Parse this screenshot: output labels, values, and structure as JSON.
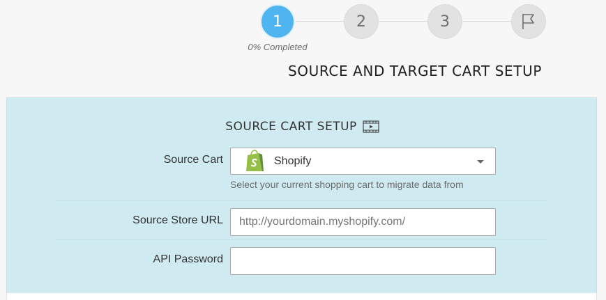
{
  "wizard": {
    "steps": [
      {
        "label": "1",
        "state": "active"
      },
      {
        "label": "2",
        "state": "pending"
      },
      {
        "label": "3",
        "state": "pending"
      },
      {
        "label": "",
        "icon": "flag-icon",
        "state": "pending"
      }
    ],
    "progress_text": "0% Completed",
    "progress_percent": 0,
    "active_color": "#4fb5f0"
  },
  "page_title": "SOURCE AND TARGET CART SETUP",
  "source_setup": {
    "title": "SOURCE CART SETUP",
    "title_icon": "video-icon",
    "source_cart": {
      "label": "Source Cart",
      "selected_value": "Shopify",
      "icon": "shopify-icon",
      "help_text": "Select your current shopping cart to migrate data from"
    },
    "store_url": {
      "label": "Source Store URL",
      "value": "",
      "placeholder": "http://yourdomain.myshopify.com/"
    },
    "api_password": {
      "label": "API Password",
      "value": "",
      "placeholder": ""
    }
  },
  "colors": {
    "panel_background": "#cfeaf0",
    "shopify_green": "#95bf47"
  }
}
